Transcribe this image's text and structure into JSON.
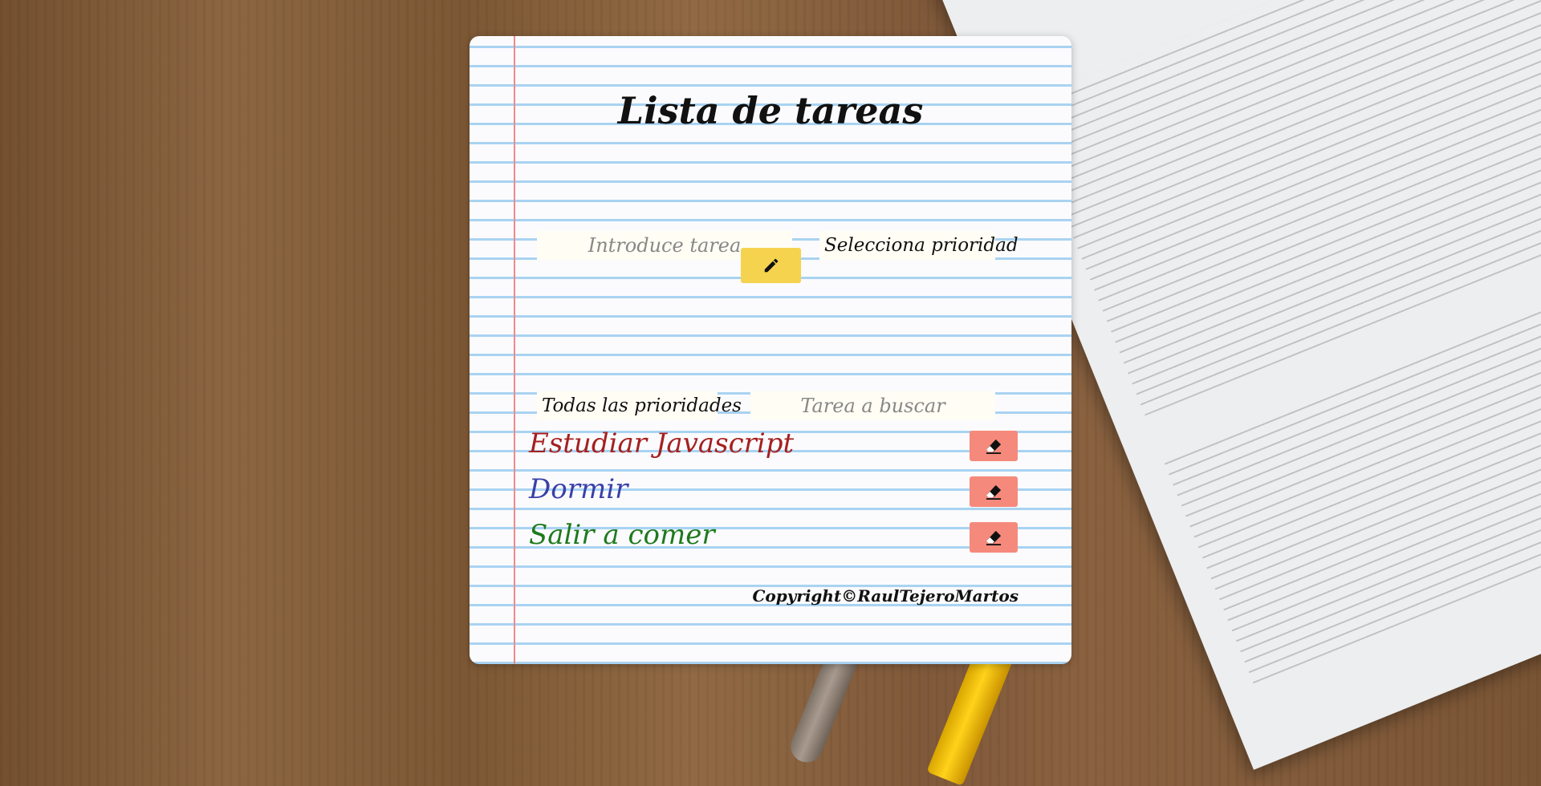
{
  "app": {
    "title": "Lista de tareas",
    "copyright": "Copyright©RaulTejeroMartos"
  },
  "form": {
    "task_placeholder": "Introduce tarea",
    "priority_select_label": "Selecciona prioridad",
    "add_icon": "pencil-icon"
  },
  "filters": {
    "priority_filter_label": "Todas las prioridades",
    "search_placeholder": "Tarea a buscar"
  },
  "tasks": [
    {
      "label": "Estudiar Javascript",
      "color": "#a52020",
      "delete_icon": "eraser-icon"
    },
    {
      "label": "Dormir",
      "color": "#3a40a8",
      "delete_icon": "eraser-icon"
    },
    {
      "label": "Salir a comer",
      "color": "#1e7a1e",
      "delete_icon": "eraser-icon"
    }
  ],
  "colors": {
    "add_button": "#f5d34e",
    "delete_button": "#f58a7c",
    "ruled_line": "#a9d3f2",
    "margin_line": "#ef8a8a"
  }
}
